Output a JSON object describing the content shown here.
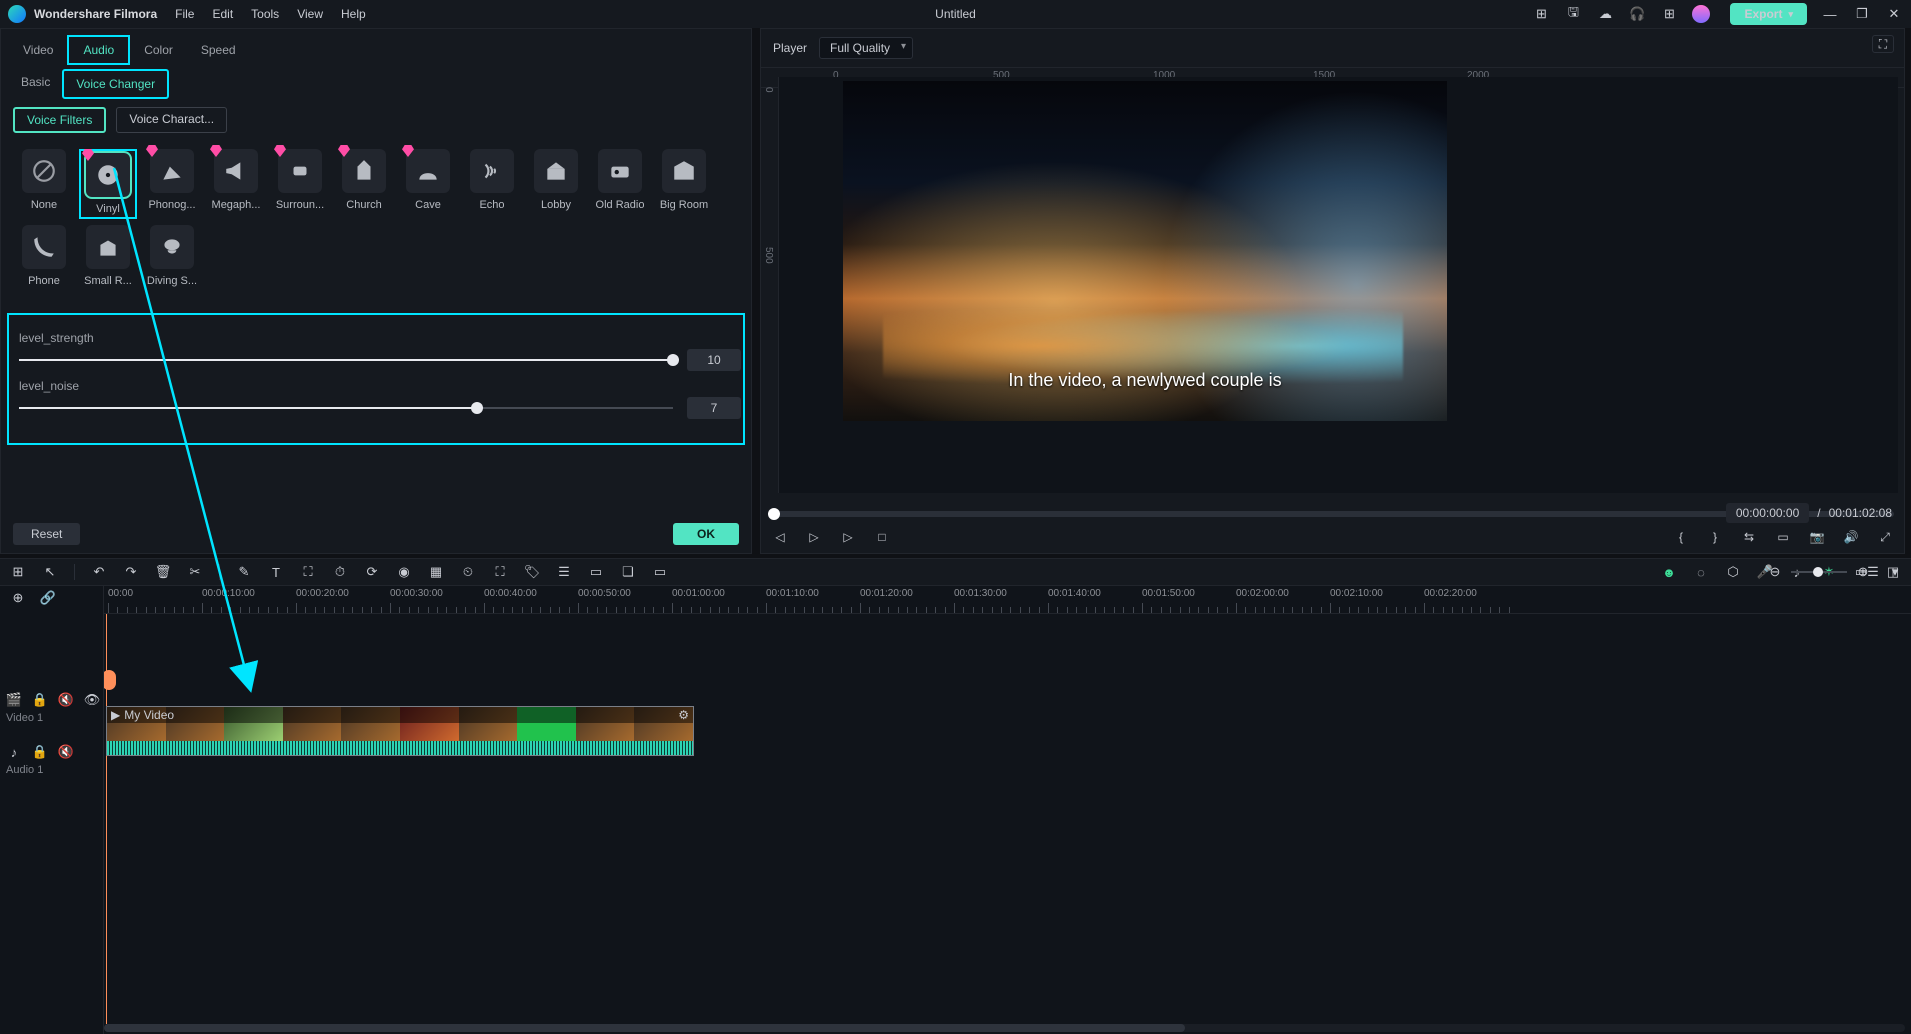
{
  "app": {
    "name": "Wondershare Filmora",
    "doc_title": "Untitled",
    "menu": [
      "File",
      "Edit",
      "Tools",
      "View",
      "Help"
    ],
    "export_label": "Export"
  },
  "left_panel": {
    "top_tabs": [
      "Video",
      "Audio",
      "Color",
      "Speed"
    ],
    "top_selected": 1,
    "sub_tabs": [
      "Basic",
      "Voice Changer"
    ],
    "sub_selected": 1,
    "chips": [
      "Voice Filters",
      "Voice Charact..."
    ],
    "chip_selected": 0,
    "filters": [
      "None",
      "Vinyl",
      "Phonog...",
      "Megaph...",
      "Surroun...",
      "Church",
      "Cave",
      "Echo",
      "Lobby",
      "Old Radio",
      "Big Room",
      "Phone",
      "Small R...",
      "Diving S..."
    ],
    "filters_premium": [
      false,
      true,
      true,
      true,
      true,
      true,
      true,
      false,
      false,
      false,
      false,
      false,
      false,
      false
    ],
    "filter_selected": 1,
    "slider1": {
      "label": "level_strength",
      "value": 10,
      "max": 10
    },
    "slider2": {
      "label": "level_noise",
      "value": 7,
      "max": 10
    },
    "reset_label": "Reset",
    "ok_label": "OK"
  },
  "player": {
    "label": "Player",
    "quality": "Full Quality",
    "ruler_h": [
      "0",
      "500",
      "1000",
      "1500",
      "2000"
    ],
    "ruler_v": [
      "0",
      "500"
    ],
    "caption": "In the video, a newlywed couple is",
    "time_current": "00:00:00:00",
    "time_total": "00:01:02:08"
  },
  "timeline": {
    "ruler": [
      "00:00",
      "00:00:10:00",
      "00:00:20:00",
      "00:00:30:00",
      "00:00:40:00",
      "00:00:50:00",
      "00:01:00:00",
      "00:01:10:00",
      "00:01:20:00",
      "00:01:30:00",
      "00:01:40:00",
      "00:01:50:00",
      "00:02:00:00",
      "00:02:10:00",
      "00:02:20:00"
    ],
    "tracks": [
      {
        "id": "video1",
        "label": "Video 1"
      },
      {
        "id": "audio1",
        "label": "Audio 1"
      }
    ],
    "clip_name": "My Video"
  }
}
